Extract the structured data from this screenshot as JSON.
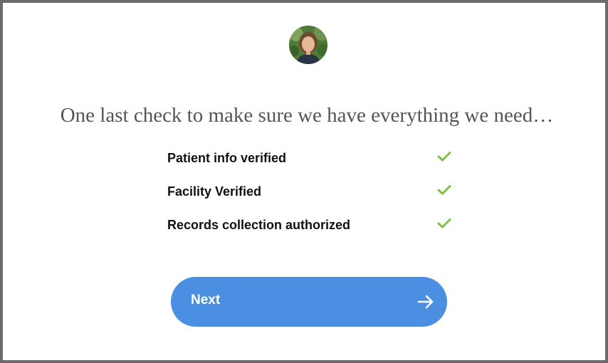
{
  "headline": "One last check to make sure we have everything we need…",
  "checklist": [
    {
      "label": "Patient info verified",
      "checked": true,
      "icon": "check-icon"
    },
    {
      "label": "Facility Verified",
      "checked": true,
      "icon": "check-icon"
    },
    {
      "label": "Records collection authorized",
      "checked": true,
      "icon": "check-icon"
    }
  ],
  "next_button": {
    "label": "Next",
    "icon": "arrow-right-icon"
  },
  "colors": {
    "check": "#7ac142",
    "button": "#4a8fe2",
    "border": "#6b6b6b"
  }
}
